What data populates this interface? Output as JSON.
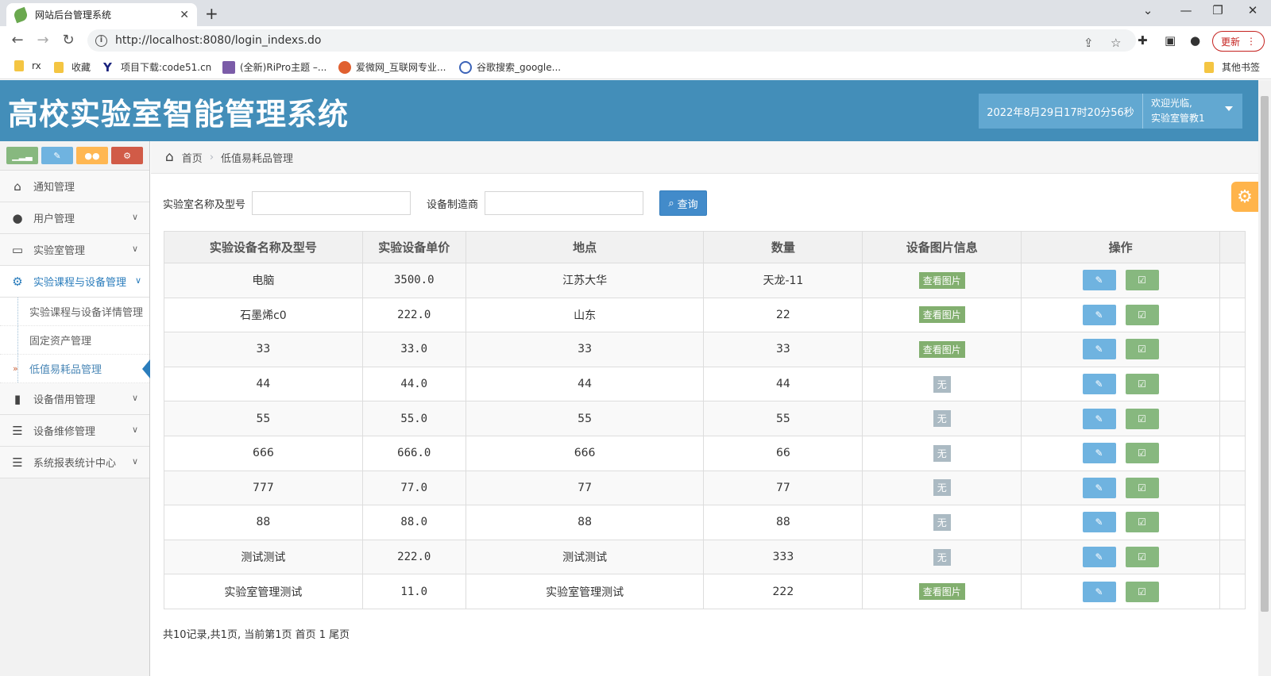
{
  "browser": {
    "tab_title": "网站后台管理系统",
    "url": "http://localhost:8080/login_indexs.do",
    "update_label": "更新",
    "bookmarks": [
      "rx",
      "收藏",
      "项目下载:code51.cn",
      "(全新)RiPro主题 –...",
      "爱微网_互联网专业...",
      "谷歌搜索_google..."
    ],
    "other_bookmarks": "其他书签"
  },
  "header": {
    "title": "高校实验室智能管理系统",
    "datetime": "2022年8月29日17时20分56秒",
    "welcome": "欢迎光临,",
    "username": "实验室管教1"
  },
  "sidebar": {
    "items": [
      {
        "label": "通知管理",
        "icon": "home-icon"
      },
      {
        "label": "用户管理",
        "icon": "users-icon"
      },
      {
        "label": "实验室管理",
        "icon": "desktop-icon"
      },
      {
        "label": "实验课程与设备管理",
        "icon": "cogs-icon"
      },
      {
        "label": "设备借用管理",
        "icon": "bookmark-icon"
      },
      {
        "label": "设备维修管理",
        "icon": "list-icon"
      },
      {
        "label": "系统报表统计中心",
        "icon": "list-icon"
      }
    ],
    "subitems": [
      "实验课程与设备详情管理",
      "固定资产管理",
      "低值易耗品管理"
    ]
  },
  "breadcrumb": {
    "home": "首页",
    "current": "低值易耗品管理"
  },
  "search": {
    "label1": "实验室名称及型号",
    "label2": "设备制造商",
    "value1": "",
    "value2": "",
    "button": "查询"
  },
  "table": {
    "headers": [
      "实验设备名称及型号",
      "实验设备单价",
      "地点",
      "数量",
      "设备图片信息",
      "操作"
    ],
    "rows": [
      {
        "name": "电脑",
        "price": "3500.0",
        "place": "江苏大华",
        "qty": "天龙-11",
        "pic": "查看图片"
      },
      {
        "name": "石墨烯c0",
        "price": "222.0",
        "place": "山东",
        "qty": "22",
        "pic": "查看图片"
      },
      {
        "name": "33",
        "price": "33.0",
        "place": "33",
        "qty": "33",
        "pic": "查看图片"
      },
      {
        "name": "44",
        "price": "44.0",
        "place": "44",
        "qty": "44",
        "pic": "无"
      },
      {
        "name": "55",
        "price": "55.0",
        "place": "55",
        "qty": "55",
        "pic": "无"
      },
      {
        "name": "666",
        "price": "666.0",
        "place": "666",
        "qty": "66",
        "pic": "无"
      },
      {
        "name": "777",
        "price": "77.0",
        "place": "77",
        "qty": "77",
        "pic": "无"
      },
      {
        "name": "88",
        "price": "88.0",
        "place": "88",
        "qty": "88",
        "pic": "无"
      },
      {
        "name": "测试测试",
        "price": "222.0",
        "place": "测试测试",
        "qty": "333",
        "pic": "无"
      },
      {
        "name": "实验室管理测试",
        "price": "11.0",
        "place": "实验室管理测试",
        "qty": "222",
        "pic": "查看图片"
      }
    ]
  },
  "pager": "共10记录,共1页, 当前第1页 首页 1 尾页"
}
